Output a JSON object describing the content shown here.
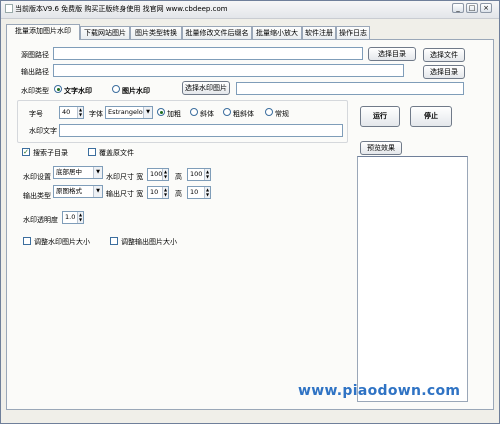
{
  "window": {
    "title": "当前版本V9.6 免费版 购买正版终身使用 找官网 www.cbdeep.com",
    "minimize": "_",
    "maximize": "□",
    "close": "×"
  },
  "tabs": [
    {
      "label": "批量添加图片水印",
      "active": true
    },
    {
      "label": "下载网站图片",
      "active": false
    },
    {
      "label": "图片类型转换",
      "active": false
    },
    {
      "label": "批量修改文件后缀名",
      "active": false
    },
    {
      "label": "批量缩小放大",
      "active": false
    },
    {
      "label": "软件注册",
      "active": false
    },
    {
      "label": "操作日志",
      "active": false
    }
  ],
  "paths": {
    "source_label": "源图路径",
    "source_value": "",
    "output_label": "输出路径",
    "output_value": "",
    "select_dir": "选择目录",
    "select_file": "选择文件",
    "select_output_dir": "选择目录"
  },
  "watermark_type": {
    "label": "水印类型",
    "text_option": "文字水印",
    "image_option": "图片水印",
    "selected": "文字水印",
    "select_image_button": "选择水印图片",
    "image_path": ""
  },
  "text_settings": {
    "size_label": "字号",
    "size_value": "40",
    "font_label": "字体",
    "font_value": "Estrangelo",
    "styles": [
      "加粗",
      "斜体",
      "粗斜体",
      "常规"
    ],
    "selected_style": "加粗",
    "text_label": "水印文字",
    "text_value": ""
  },
  "actions": {
    "run": "运行",
    "stop": "停止",
    "preview": "预览效果"
  },
  "options": {
    "search_subdirs": "搜索子目录",
    "search_subdirs_checked": true,
    "overwrite": "覆盖原文件",
    "overwrite_checked": false
  },
  "placement": {
    "position_label": "水印设置",
    "position_value": "底部居中",
    "wm_size_label": "水印尺寸 宽",
    "wm_width": "100",
    "height_label": "高",
    "wm_height": "100",
    "output_type_label": "输出类型",
    "output_type_value": "原图格式",
    "out_size_label": "输出尺寸 宽",
    "out_width": "10",
    "out_height_label": "高",
    "out_height": "10"
  },
  "opacity": {
    "label": "水印透明度",
    "value": "1.0"
  },
  "resize": {
    "adjust_wm": "调整水印图片大小",
    "adjust_output": "调整输出图片大小"
  },
  "footer": {
    "site": "www.piaodown.com"
  },
  "colors": {
    "accent": "#2f73c4",
    "window_bg": "#f0efe9"
  }
}
